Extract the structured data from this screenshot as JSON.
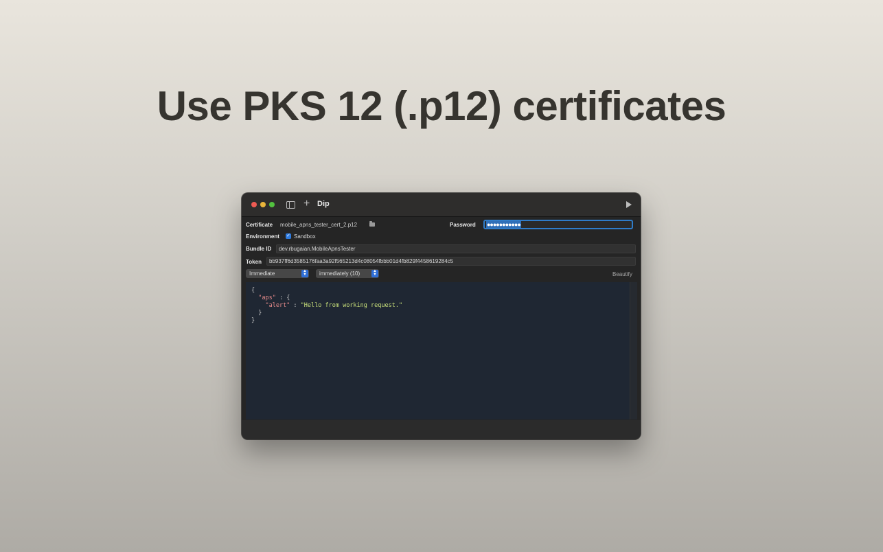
{
  "headline": "Use PKS 12 (.p12) certificates",
  "window": {
    "title": "Dip",
    "icons": [
      "sidebar-toggle-icon",
      "plus-icon",
      "play-icon"
    ]
  },
  "form": {
    "certificate_label": "Certificate",
    "certificate_value": "mobile_apns_tester_cert_2.p12",
    "password_label": "Password",
    "password_value": "●●●●●●●●●●●",
    "environment_label": "Environment",
    "sandbox_label": "Sandbox",
    "sandbox_checked": true,
    "bundle_id_label": "Bundle ID",
    "bundle_id_value": "dev.rbugaian.MobileApnsTester",
    "token_label": "Token",
    "token_value": "bb937ff6d3585176faa3a92f565213d4c08054fbbb01d4fb829f4458619284c5",
    "priority_select": "Immediate",
    "expiration_select": "immediately (10)",
    "beautify_label": "Beautify"
  },
  "payload": {
    "line1": "{",
    "aps_key": "\"aps\"",
    "aps_sep": " : {",
    "alert_key": "\"alert\"",
    "alert_sep": " : ",
    "alert_value": "\"Hello from working request.\"",
    "close_inner": "}",
    "close_outer": "}"
  },
  "colors": {
    "accent": "#2f7ce0",
    "editor_bg": "#1f2733",
    "window_bg": "#252525"
  }
}
